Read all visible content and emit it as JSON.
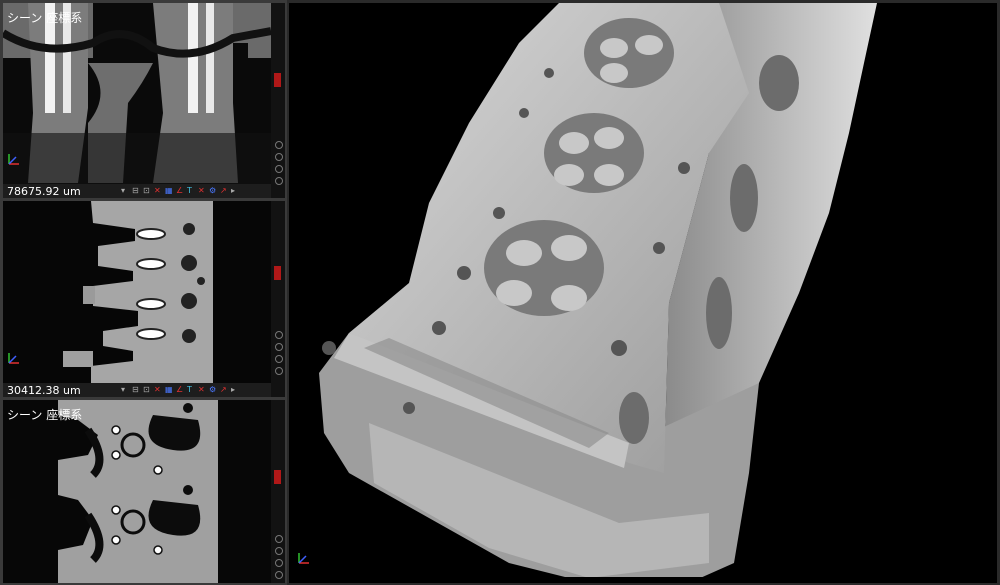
{
  "views": {
    "top": {
      "label": "シーン 座標系",
      "measurement": "78675.92 um"
    },
    "middle": {
      "measurement": "30412.38 um"
    },
    "bottom": {
      "label": "シーン 座標系"
    }
  },
  "toolbar_icons": [
    "ruler-icon",
    "cursor-icon",
    "slice-x-icon",
    "slice-y-icon",
    "text-icon",
    "angle-icon",
    "delete-icon",
    "settings-icon"
  ],
  "colors": {
    "active_border": "#a02020",
    "marker": "#b01818",
    "axis_x": "#e03030",
    "axis_y": "#30c030",
    "axis_z": "#4060ff"
  }
}
